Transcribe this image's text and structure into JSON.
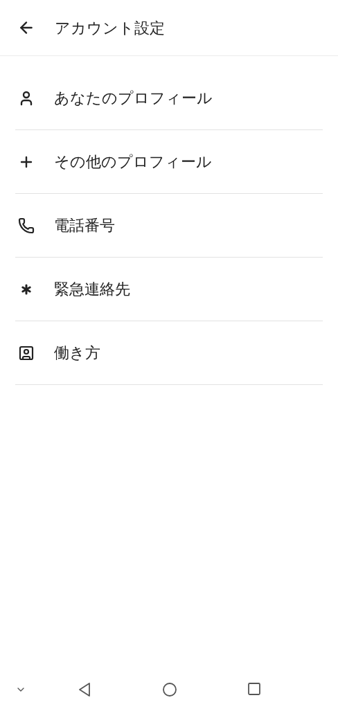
{
  "header": {
    "title": "アカウント設定"
  },
  "items": [
    {
      "kind": "person",
      "label": "あなたのプロフィール"
    },
    {
      "kind": "plus",
      "label": "その他のプロフィール"
    },
    {
      "kind": "phone",
      "label": "電話番号"
    },
    {
      "kind": "asterisk",
      "label": "緊急連絡先"
    },
    {
      "kind": "portrait",
      "label": "働き方"
    }
  ]
}
